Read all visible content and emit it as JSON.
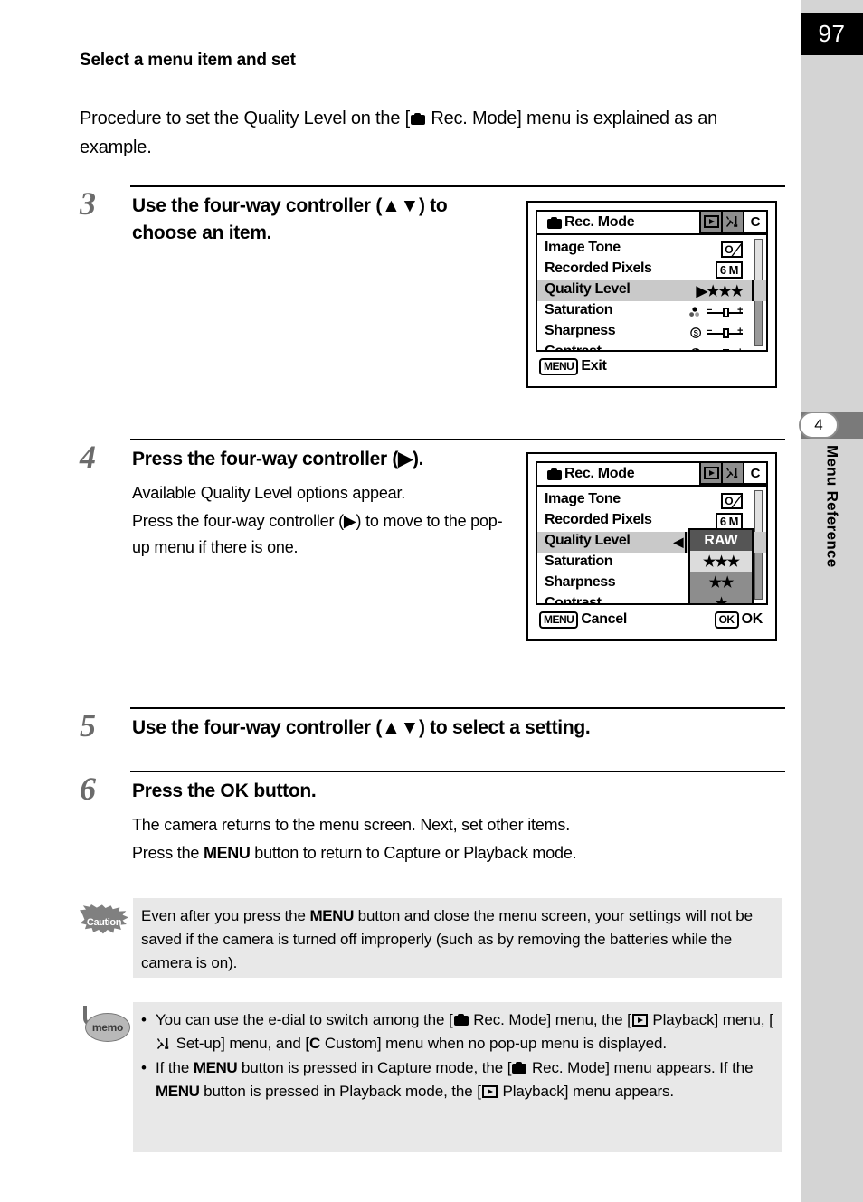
{
  "sidebar": {
    "page_number": "97",
    "chapter_number": "4",
    "chapter_title": "Menu Reference"
  },
  "section": {
    "heading": "Select a menu item and set",
    "intro_before_icon": "Procedure to set the Quality Level on the [",
    "intro_icon": "camera-icon",
    "intro_after_icon": " Rec. Mode] menu is explained as an example."
  },
  "steps": [
    {
      "number": "3",
      "title": "Use the four-way controller (▲▼) to choose an item.",
      "paragraphs": []
    },
    {
      "number": "4",
      "title": "Press the four-way controller (▶).",
      "paragraphs": [
        "Available Quality Level options appear.",
        "Press the four-way controller (▶) to move to the pop-up menu if there is one."
      ]
    },
    {
      "number": "5",
      "title": "Use the four-way controller (▲▼) to select a setting.",
      "paragraphs": []
    },
    {
      "number": "6",
      "title_before_ok": "Press the ",
      "title_ok": "OK",
      "title_after_ok": " button.",
      "paragraphs": [
        "The camera returns to the menu screen. Next, set other items.",
        "Press the MENU button to return to Capture or Playback mode."
      ],
      "para2_before_menu": "Press the ",
      "para2_menu": "MENU",
      "para2_after_menu": " button to return to Capture or Playback mode."
    }
  ],
  "lcd_step3": {
    "title": "Rec. Mode",
    "title_icon": "camera-icon",
    "tabs": [
      "playback-icon",
      "setup-icon",
      "C"
    ],
    "menu_items": [
      {
        "label": "Image Tone",
        "value": "image-tone-icon",
        "selected": false
      },
      {
        "label": "Recorded Pixels",
        "value": "6 M",
        "selected": false
      },
      {
        "label": "Quality Level",
        "value": "▶★★★",
        "selected": true
      },
      {
        "label": "Saturation",
        "value": "saturation-slider",
        "selected": false
      },
      {
        "label": "Sharpness",
        "value": "sharpness-slider",
        "selected": false
      },
      {
        "label": "Contrast",
        "value": "contrast-slider",
        "selected": false
      }
    ],
    "footer_left_key": "MENU",
    "footer_left_label": "Exit"
  },
  "lcd_step4": {
    "title": "Rec. Mode",
    "title_icon": "camera-icon",
    "tabs": [
      "playback-icon",
      "setup-icon",
      "C"
    ],
    "menu_items": [
      {
        "label": "Image Tone",
        "value": "image-tone-icon",
        "selected": false
      },
      {
        "label": "Recorded Pixels",
        "value": "6 M",
        "selected": false
      },
      {
        "label": "Quality Level",
        "value": "◀",
        "selected": true
      },
      {
        "label": "Saturation",
        "value": "",
        "selected": false
      },
      {
        "label": "Sharpness",
        "value": "",
        "selected": false
      },
      {
        "label": "Contrast",
        "value": "",
        "selected": false
      }
    ],
    "popup_options": [
      {
        "label": "RAW",
        "state": "current"
      },
      {
        "label": "★★★",
        "state": "highlighted"
      },
      {
        "label": "★★",
        "state": "normal"
      },
      {
        "label": "★",
        "state": "normal"
      }
    ],
    "footer_left_key": "MENU",
    "footer_left_label": "Cancel",
    "footer_right_key": "OK",
    "footer_right_label": "OK"
  },
  "caution": {
    "icon_label": "Caution",
    "text_part1": "Even after you press the ",
    "text_menu": "MENU",
    "text_part2": " button and close the menu screen, your settings will not be saved if the camera is turned off improperly (such as by removing the batteries while the camera is on)."
  },
  "memo": {
    "icon_label": "memo",
    "bullet1": {
      "p1": "You can use the e-dial to switch among the [",
      "p2": " Rec. Mode] menu, the [",
      "p3": " Playback] menu, [",
      "p4": " Set-up] menu, and [",
      "p5": "C",
      "p6": " Custom] menu when no pop-up menu is displayed."
    },
    "bullet2": {
      "p1": "If the ",
      "menu1": "MENU",
      "p2": " button is pressed in Capture mode, the [",
      "p3": " Rec. Mode] menu appears. If the ",
      "menu2": "MENU",
      "p4": " button is pressed in Playback mode, the [",
      "p5": " Playback] menu appears."
    }
  },
  "colors": {
    "sidebar_bg": "#d4d4d4",
    "page_number_bg": "#000000",
    "chapter_tab_bg": "#7a7a7a",
    "note_bg": "#e8e8e8",
    "step_numeral": "#6b6b6b",
    "lcd_selected": "#c9c9c9",
    "popup_bg": "#8d8d8d",
    "popup_current": "#555555",
    "popup_highlight": "#dcdcdc"
  }
}
